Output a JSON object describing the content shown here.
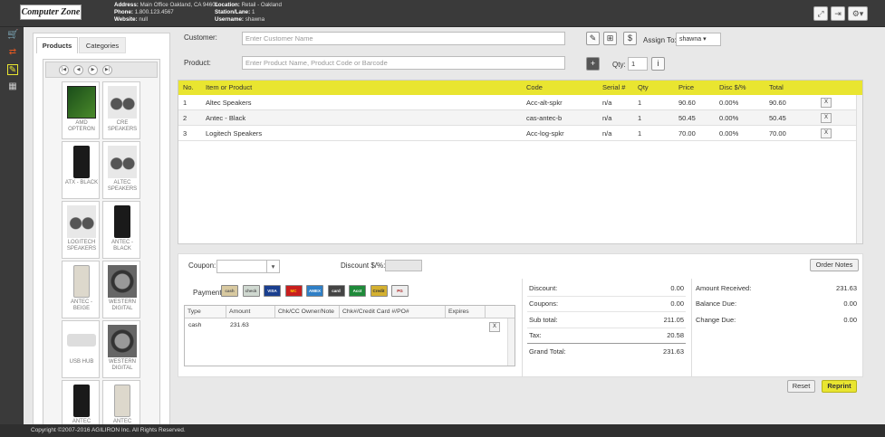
{
  "header": {
    "logo": "Computer Zone",
    "address_label": "Address:",
    "address": "Main Office Oakland, CA 94601",
    "phone_label": "Phone:",
    "phone": "1.800.123.4567",
    "website_label": "Website:",
    "website": "null",
    "location_label": "Location:",
    "location": "Retail - Oakland",
    "station_label": "Station/Lane:",
    "station": "1",
    "username_label": "Username:",
    "username": "shawna"
  },
  "left_panel": {
    "tabs": [
      "Products",
      "Categories"
    ],
    "products": [
      {
        "label": "AMD OPTERON",
        "icon": "cpu-box"
      },
      {
        "label": "CRE SPEAKERS",
        "icon": "speakers"
      },
      {
        "label": "ATX - BLACK",
        "icon": "tower-black"
      },
      {
        "label": "ALTEC SPEAKERS",
        "icon": "speakers"
      },
      {
        "label": "LOGITECH SPEAKERS",
        "icon": "speakers"
      },
      {
        "label": "ANTEC - BLACK",
        "icon": "tower-black"
      },
      {
        "label": "ANTEC - BEIGE",
        "icon": "tower-beige"
      },
      {
        "label": "WESTERN DIGITAL",
        "icon": "hard-drive"
      },
      {
        "label": "USB HUB",
        "icon": "usb-hub"
      },
      {
        "label": "WESTERN DIGITAL",
        "icon": "hard-drive"
      },
      {
        "label": "ANTEC",
        "icon": "tower-black"
      },
      {
        "label": "ANTEC",
        "icon": "tower-beige"
      }
    ]
  },
  "form": {
    "customer_label": "Customer:",
    "customer_placeholder": "Enter Customer Name",
    "product_label": "Product:",
    "product_placeholder": "Enter Product Name, Product Code or Barcode",
    "assign_label": "Assign To:",
    "assign_value": "shawna",
    "qty_label": "Qty:",
    "qty_value": "1"
  },
  "grid": {
    "headers": [
      "No.",
      "Item or Product",
      "Code",
      "Serial #",
      "Qty",
      "Price",
      "Disc $/%",
      "Total"
    ],
    "rows": [
      {
        "no": "1",
        "item": "Altec Speakers",
        "code": "Acc-alt-spkr",
        "serial": "n/a",
        "qty": "1",
        "price": "90.60",
        "disc": "0.00%",
        "total": "90.60"
      },
      {
        "no": "2",
        "item": "Antec - Black",
        "code": "cas-antec-b",
        "serial": "n/a",
        "qty": "1",
        "price": "50.45",
        "disc": "0.00%",
        "total": "50.45"
      },
      {
        "no": "3",
        "item": "Logitech Speakers",
        "code": "Acc-log-spkr",
        "serial": "n/a",
        "qty": "1",
        "price": "70.00",
        "disc": "0.00%",
        "total": "70.00"
      }
    ],
    "remove_label": "X"
  },
  "bottom": {
    "coupon_label": "Coupon:",
    "discount_label": "Discount $/%:",
    "order_notes": "Order Notes",
    "payment_label": "Payment",
    "cards": [
      "cash",
      "check",
      "VISA",
      "MC",
      "AMEX",
      "card",
      "Acct",
      "Credit",
      "PG"
    ],
    "pay_headers": [
      "Type",
      "Amount",
      "Chk/CC Owner/Note",
      "Chk#/Credit Card #/PO#",
      "Expires"
    ],
    "pay_row": {
      "type": "cash",
      "amount": "231.63"
    },
    "summary": [
      {
        "label": "Discount:",
        "value": "0.00"
      },
      {
        "label": "Coupons:",
        "value": "0.00"
      },
      {
        "label": "Sub total:",
        "value": "211.05"
      },
      {
        "label": "Tax:",
        "value": "20.58"
      },
      {
        "label": "Grand Total:",
        "value": "231.63"
      }
    ],
    "received": [
      {
        "label": "Amount Received:",
        "value": "231.63"
      },
      {
        "label": "Balance Due:",
        "value": "0.00"
      },
      {
        "label": "Change Due:",
        "value": "0.00"
      }
    ],
    "reset": "Reset",
    "reprint": "Reprint"
  },
  "footer": "Copyright ©2007-2016 AGILIRON Inc. All Rights Reserved.",
  "colors": {
    "accent_yellow": "#e9e530",
    "dark_bar": "#3a3a3a"
  }
}
